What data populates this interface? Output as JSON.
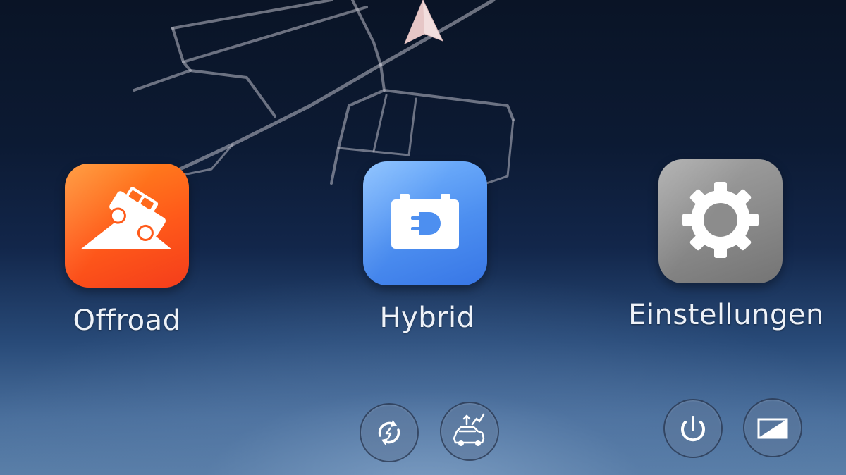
{
  "apps": {
    "offroad": {
      "label": "Offroad",
      "icon": "offroad-slope-icon",
      "color": "#ff5a1a"
    },
    "hybrid": {
      "label": "Hybrid",
      "icon": "battery-plug-icon",
      "color": "#4d8ff0"
    },
    "settings": {
      "label": "Einstellungen",
      "icon": "gear-icon",
      "color": "#8a8a8a"
    }
  },
  "bottom_buttons": [
    {
      "icon": "sync-icon"
    },
    {
      "icon": "car-energy-flow-icon"
    },
    {
      "icon": "power-icon"
    },
    {
      "icon": "display-brightness-icon"
    }
  ],
  "map": {
    "position_marker": "navigation-arrow-icon"
  }
}
